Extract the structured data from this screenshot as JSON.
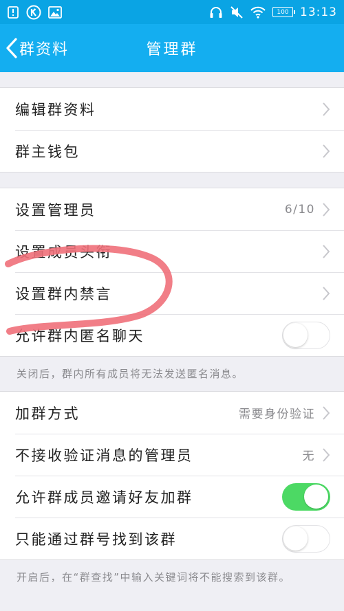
{
  "status_bar": {
    "battery": "100",
    "time": "13:13"
  },
  "nav": {
    "back_label": "群资料",
    "title": "管理群"
  },
  "groups": [
    {
      "rows": [
        {
          "label": "编辑群资料"
        },
        {
          "label": "群主钱包"
        }
      ]
    },
    {
      "rows": [
        {
          "label": "设置管理员",
          "value": "6/10"
        },
        {
          "label": "设置成员头衔"
        },
        {
          "label": "设置群内禁言"
        },
        {
          "label": "允许群内匿名聊天",
          "toggle": false
        }
      ],
      "note": "关闭后，群内所有成员将无法发送匿名消息。"
    },
    {
      "rows": [
        {
          "label": "加群方式",
          "value": "需要身份验证"
        },
        {
          "label": "不接收验证消息的管理员",
          "value": "无"
        },
        {
          "label": "允许群成员邀请好友加群",
          "toggle": true
        },
        {
          "label": "只能通过群号找到该群",
          "toggle": false
        }
      ],
      "note": "开启后，在“群查找”中输入关键词将不能搜索到该群。"
    }
  ],
  "colors": {
    "status_bar": "#0aa4e4",
    "nav_bar": "#14aef0",
    "toggle_on": "#4cd964",
    "annotation": "#f0707a"
  }
}
